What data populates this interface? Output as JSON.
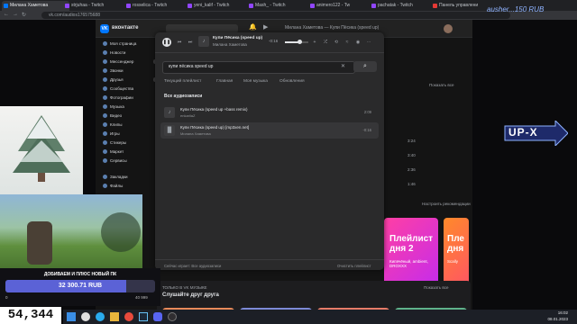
{
  "browser": {
    "tabs": [
      {
        "label": "Милана Хаметова",
        "active": true,
        "color": "#0077ff"
      },
      {
        "label": "strjuhaa - Twitch",
        "active": false,
        "color": "#9146ff"
      },
      {
        "label": "rosselica - Twitch",
        "active": false,
        "color": "#9146ff"
      },
      {
        "label": "yeni_kalif - Twitch",
        "active": false,
        "color": "#9146ff"
      },
      {
        "label": "Mash_ - Twitch",
        "active": false,
        "color": "#9146ff"
      },
      {
        "label": "animero122 - Tw",
        "active": false,
        "color": "#9146ff"
      },
      {
        "label": "pachatak - Twitch",
        "active": false,
        "color": "#9146ff"
      },
      {
        "label": "Панель управлени",
        "active": false,
        "color": "#e53935"
      }
    ],
    "url": "vk.com/audios176575688"
  },
  "vk": {
    "logo": "VK",
    "brand": "вконтакте",
    "now_playing_header": "Милана Хаметова — Купи Пёсика (speed up)",
    "sidebar": [
      {
        "label": "Моя страница",
        "count": ""
      },
      {
        "label": "Новости",
        "count": ""
      },
      {
        "label": "Мессенджер",
        "count": "477"
      },
      {
        "label": "Звонки",
        "count": ""
      },
      {
        "label": "Друзья",
        "count": "476"
      },
      {
        "label": "Сообщества",
        "count": ""
      },
      {
        "label": "Фотографии",
        "count": ""
      },
      {
        "label": "Музыка",
        "count": ""
      },
      {
        "label": "Видео",
        "count": ""
      },
      {
        "label": "Клипы",
        "count": ""
      },
      {
        "label": "Игры",
        "count": ""
      },
      {
        "label": "Стикеры",
        "count": ""
      },
      {
        "label": "Маркет",
        "count": ""
      },
      {
        "label": "Сервисы",
        "count": ""
      },
      {
        "label": "Закладки",
        "count": ""
      },
      {
        "label": "Файлы",
        "count": ""
      }
    ],
    "background": {
      "list_title": "Показать все",
      "rows": [
        {
          "text": "3:24",
          "meta": "Показать все"
        },
        {
          "text": "3:40",
          "meta": "de"
        },
        {
          "text": "2:36",
          "meta": "core x reverb)"
        },
        {
          "text": "1:46",
          "meta": "Ка"
        }
      ],
      "recommend_link": "Настроить рекомендации",
      "promo_1_title": "Плейлист дня 2",
      "promo_1_sub": "Кипячёный, ambient, DROXXX",
      "promo_2_title": "Пле дня",
      "promo_2_sub": "Scally",
      "only_vk": "ТОЛЬКО В VK МУЗЫКЕ",
      "listen_friends": "Слушайте друг друга",
      "show_all_2": "Показать все"
    }
  },
  "player": {
    "track_title": "Купи Пёсика (speed up)",
    "track_artist": "Милана Хаметова",
    "elapsed": "-0:16",
    "progress": 0.62
  },
  "search": {
    "value": "купи пёсика speed up",
    "clear": "✕",
    "button": "⌕"
  },
  "tabs": [
    "Текущий плейлист",
    "Главная",
    "Моя музыка",
    "Обновления"
  ],
  "results": {
    "section_title": "Все аудиозаписи",
    "tracks": [
      {
        "title": "Купи Пёсика (speed up +bass remix)",
        "artist": "enkariiaZ",
        "duration": "2:09",
        "highlight": false
      },
      {
        "title": "Купи Пёсика (speed up) [mp3xen.net]",
        "artist": "Милана Хаметова",
        "duration": "-0:16",
        "highlight": true
      }
    ]
  },
  "footer": {
    "left": "Сейчас играет: Все аудиозаписи",
    "right": "Очистить плейлист"
  },
  "stream": {
    "donation_title": "ДОБИВАЕМ И ПЛЮС НОВЫЙ ПК",
    "donation_amount": "32 300.71 RUB",
    "donation_progress": 0.81,
    "donation_start": "0",
    "donation_goal": "40 999",
    "viewers": "54,344",
    "overlay_title": "ausher...150 RUB",
    "logo_text": "UP-X"
  },
  "taskbar": {
    "time": "16:02",
    "date": "08.01.2023"
  }
}
